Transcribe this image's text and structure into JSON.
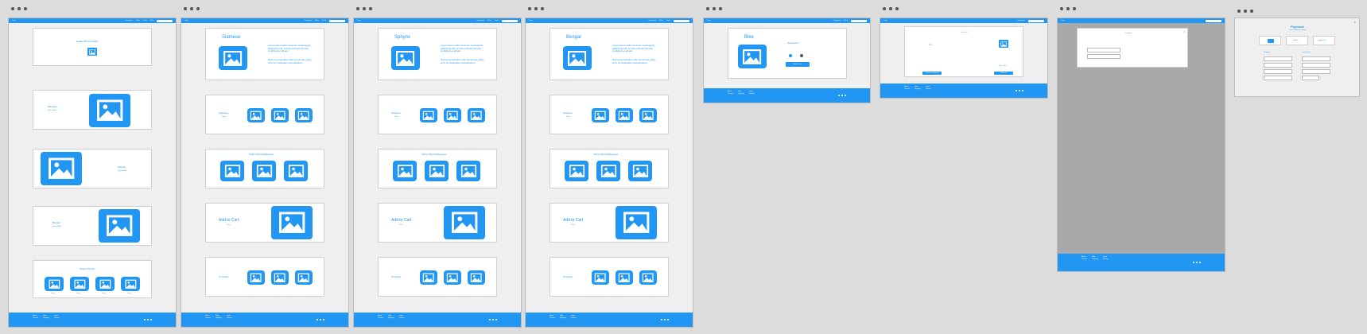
{
  "nav": {
    "logo": "Logo",
    "items": [
      "Categories",
      "Shop",
      "Deals",
      "Help"
    ],
    "search_placeholder": "Search"
  },
  "footer": {
    "cols": [
      [
        "About",
        "Careers",
        "Press"
      ],
      [
        "Help",
        "Shipping",
        "Returns",
        "FAQ"
      ],
      [
        "Legal",
        "Privacy",
        "Terms"
      ]
    ]
  },
  "screens": {
    "home": {
      "hero_title": "Header/Promo Slide",
      "cats": [
        {
          "title": "Siamese",
          "sub": "Type of Bike"
        },
        {
          "title": "Sphynx",
          "sub": "Type of Bike"
        },
        {
          "title": "Bengal",
          "sub": "Type of Bike"
        }
      ],
      "owner_title": "Owner Photos",
      "owner_caps": [
        "Name",
        "Name",
        "Name",
        "Name"
      ]
    },
    "products": [
      {
        "title": "Siamese"
      },
      {
        "title": "Sphynx"
      },
      {
        "title": "Bengal"
      }
    ],
    "product_common": {
      "lorem1": "Lorem ipsum dolor sit amet, consectetur adipiscing elit, sed do eiusmod tempor incididunt ut labore.",
      "lorem2": "Sed ut perspiciatis unde omnis iste natus error sit voluptatem accusantium.",
      "features": "Features",
      "features_sub": "Detail",
      "owner_reviews": "Owner Photos/Reviews",
      "add_to_cart": "Add to Cart",
      "price": "Price",
      "compare": "Compare"
    },
    "bike": {
      "title": "Bike",
      "selections": "Selections",
      "button": "Add To Cart"
    },
    "cart": {
      "title": "Your Cart",
      "item": "Bike",
      "total": "Total - $00",
      "left_btn": "Continue Shopping",
      "right_btn": "Checkout"
    },
    "modal": {
      "title": "Compare"
    },
    "payment": {
      "title": "Payment",
      "subtitle": "Select payment method",
      "methods": [
        "Card",
        "PayPal",
        "Apple Pay"
      ],
      "left_head": "Shipping",
      "right_head": "Card Details"
    }
  }
}
